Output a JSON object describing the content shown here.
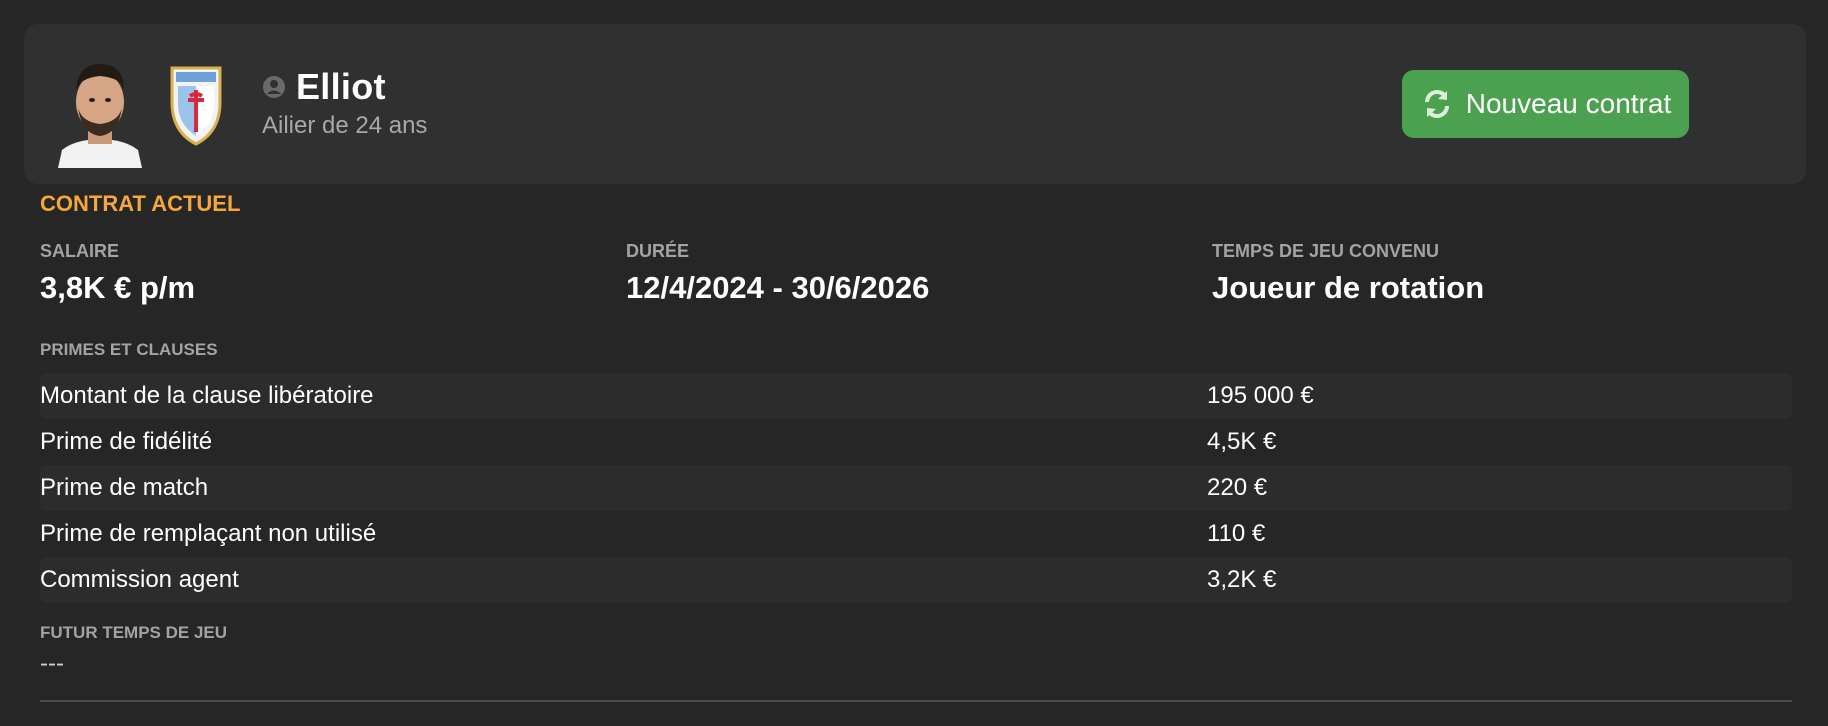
{
  "header": {
    "player_name": "Elliot",
    "player_subtitle": "Ailier de 24 ans",
    "new_contract_label": "Nouveau contrat",
    "accent_color": "#4ba14f"
  },
  "contract": {
    "section_title": "CONTRAT ACTUEL",
    "salary_label": "SALAIRE",
    "salary_value": "3,8K € p/m",
    "duration_label": "DURÉE",
    "duration_value": "12/4/2024 - 30/6/2026",
    "playtime_label": "TEMPS DE JEU CONVENU",
    "playtime_value": "Joueur de rotation"
  },
  "bonuses": {
    "title": "PRIMES ET CLAUSES",
    "rows": [
      {
        "label": "Montant de la clause libératoire",
        "value": "195 000 €"
      },
      {
        "label": "Prime de fidélité",
        "value": "4,5K €"
      },
      {
        "label": "Prime de match",
        "value": "220 €"
      },
      {
        "label": "Prime de remplaçant non utilisé",
        "value": "110 €"
      },
      {
        "label": "Commission agent",
        "value": "3,2K €"
      }
    ]
  },
  "future": {
    "title": "FUTUR TEMPS DE JEU",
    "value": "---"
  },
  "colors": {
    "section_accent": "#f5a73b",
    "background": "#262626",
    "card": "#303030"
  }
}
